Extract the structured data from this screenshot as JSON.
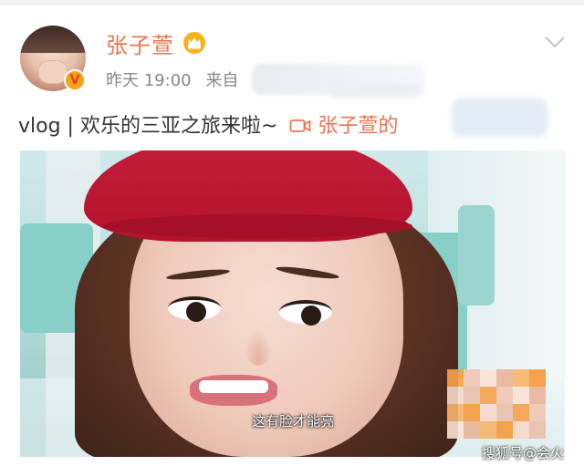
{
  "post": {
    "username": "张子萱",
    "timestamp": "昨天 19:00",
    "source_prefix": "来自",
    "text_main": "vlog | 欢乐的三亚之旅来啦~",
    "video_link_label": "张子萱的",
    "accent_color": "#eb7350"
  },
  "icons": {
    "crown": "crown-icon",
    "verified": "verified-badge-icon",
    "menu": "chevron-down-icon",
    "video": "video-camera-icon"
  },
  "video": {
    "subtitle": "这有脸才能亮"
  },
  "watermark": {
    "text": "搜狐号@会火"
  }
}
